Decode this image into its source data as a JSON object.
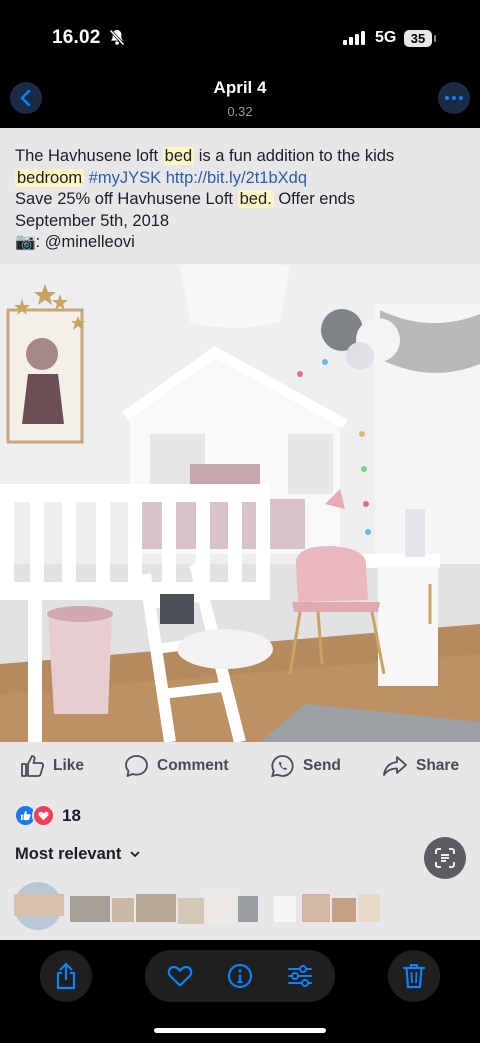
{
  "status_bar": {
    "time": "16.02",
    "network": "5G",
    "battery": "35"
  },
  "header": {
    "title": "April 4",
    "subtitle": "0.32"
  },
  "post": {
    "line1_a": "The Havhusene loft ",
    "line1_hl": "bed",
    "line1_b": " is a fun addition to the kids",
    "line2_hl": "bedroom",
    "hashtag": "#myJYSK",
    "url": "http://bit.ly/2t1bXdq",
    "line3_a": "Save 25% off Havhusene Loft ",
    "line3_hl": "bed.",
    "line3_b": " Offer ends",
    "line4": "September 5th, 2018",
    "credit_emoji": "📷",
    "credit": ": @minelleovi"
  },
  "actions": {
    "like": "Like",
    "comment": "Comment",
    "send": "Send",
    "share": "Share"
  },
  "reactions": {
    "count": "18",
    "icons": [
      "like-icon",
      "love-icon"
    ]
  },
  "comments": {
    "sort_label": "Most relevant"
  },
  "colors": {
    "accent": "#0a84ff",
    "link": "#2d5cab",
    "highlight": "#fdf6c3"
  }
}
